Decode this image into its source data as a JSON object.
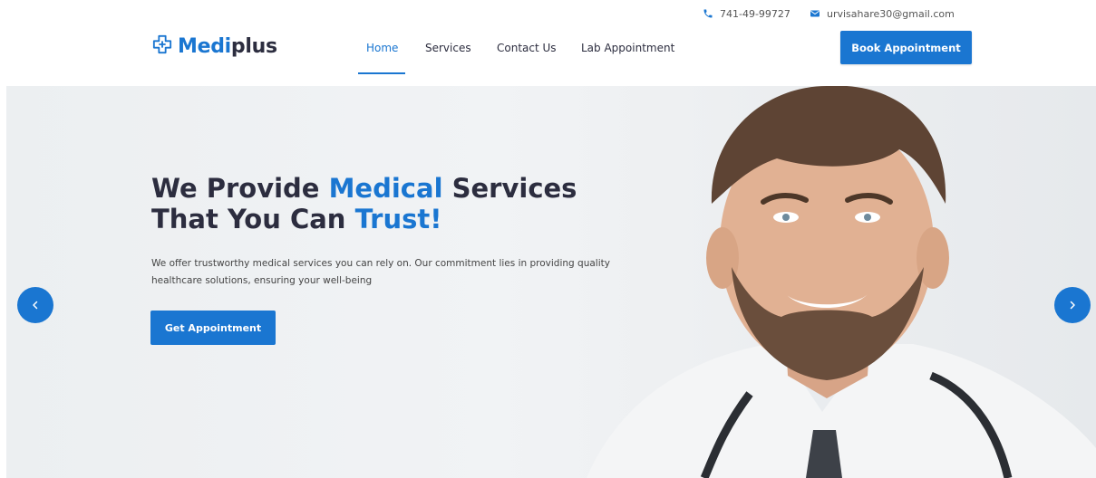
{
  "header": {
    "phone": "741-49-99727",
    "email": "urvisahare30@gmail.com",
    "logo": {
      "part1": "Medi",
      "part2": "plus"
    },
    "nav": [
      {
        "label": "Home",
        "active": true
      },
      {
        "label": "Services",
        "active": false
      },
      {
        "label": "Contact Us",
        "active": false
      },
      {
        "label": "Lab Appointment",
        "active": false
      }
    ],
    "book_button": "Book Appointment"
  },
  "hero": {
    "headline_line1_a": "We Provide ",
    "headline_line1_b": "Medical",
    "headline_line1_c": " Services",
    "headline_line2_a": "That You Can ",
    "headline_line2_b": "Trust!",
    "description": "We offer trustworthy medical services you can rely on. Our commitment lies in providing quality healthcare solutions, ensuring your well-being",
    "cta_button": "Get Appointment"
  },
  "colors": {
    "accent": "#1a76d1",
    "heading": "#2c2d3f"
  },
  "icons": {
    "phone": "phone-icon",
    "email": "envelope-icon",
    "logo": "medical-cross-icon",
    "prev": "chevron-left-icon",
    "next": "chevron-right-icon"
  }
}
